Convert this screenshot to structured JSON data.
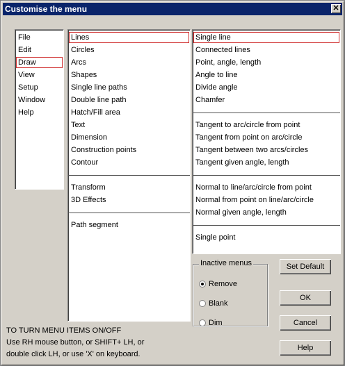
{
  "window": {
    "title": "Customise the menu",
    "close_glyph": "✕"
  },
  "menus": [
    "File",
    "Edit",
    "Draw",
    "View",
    "Setup",
    "Window",
    "Help"
  ],
  "draw_items": {
    "group1": [
      "Lines",
      "Circles",
      "Arcs",
      "Shapes",
      "Single line paths",
      "Double line path",
      "Hatch/Fill area",
      "Text",
      "Dimension",
      "Construction points",
      "Contour"
    ],
    "group2": [
      "Transform",
      "3D Effects"
    ],
    "group3": [
      "Path segment"
    ]
  },
  "line_items": {
    "group1": [
      "Single line",
      "Connected lines",
      "Point, angle, length",
      "Angle to line",
      "Divide angle",
      "Chamfer"
    ],
    "group2": [
      "Tangent to arc/circle from point",
      "Tangent from point on arc/circle",
      "Tangent between two arcs/circles",
      "Tangent given angle, length"
    ],
    "group3": [
      "Normal to line/arc/circle from point",
      "Normal from point on line/arc/circle",
      "Normal given angle, length"
    ],
    "group4": [
      "Single point"
    ]
  },
  "inactive_menus": {
    "label": "Inactive menus",
    "options": [
      "Remove",
      "Blank",
      "Dim"
    ],
    "selected": "Remove"
  },
  "buttons": {
    "set_default": "Set Default",
    "ok": "OK",
    "cancel": "Cancel",
    "help": "Help"
  },
  "hint": {
    "line1": "TO TURN MENU ITEMS ON/OFF",
    "line2": "Use RH mouse button, or SHIFT+ LH, or",
    "line3": "double click LH, or use 'X' on keyboard."
  }
}
